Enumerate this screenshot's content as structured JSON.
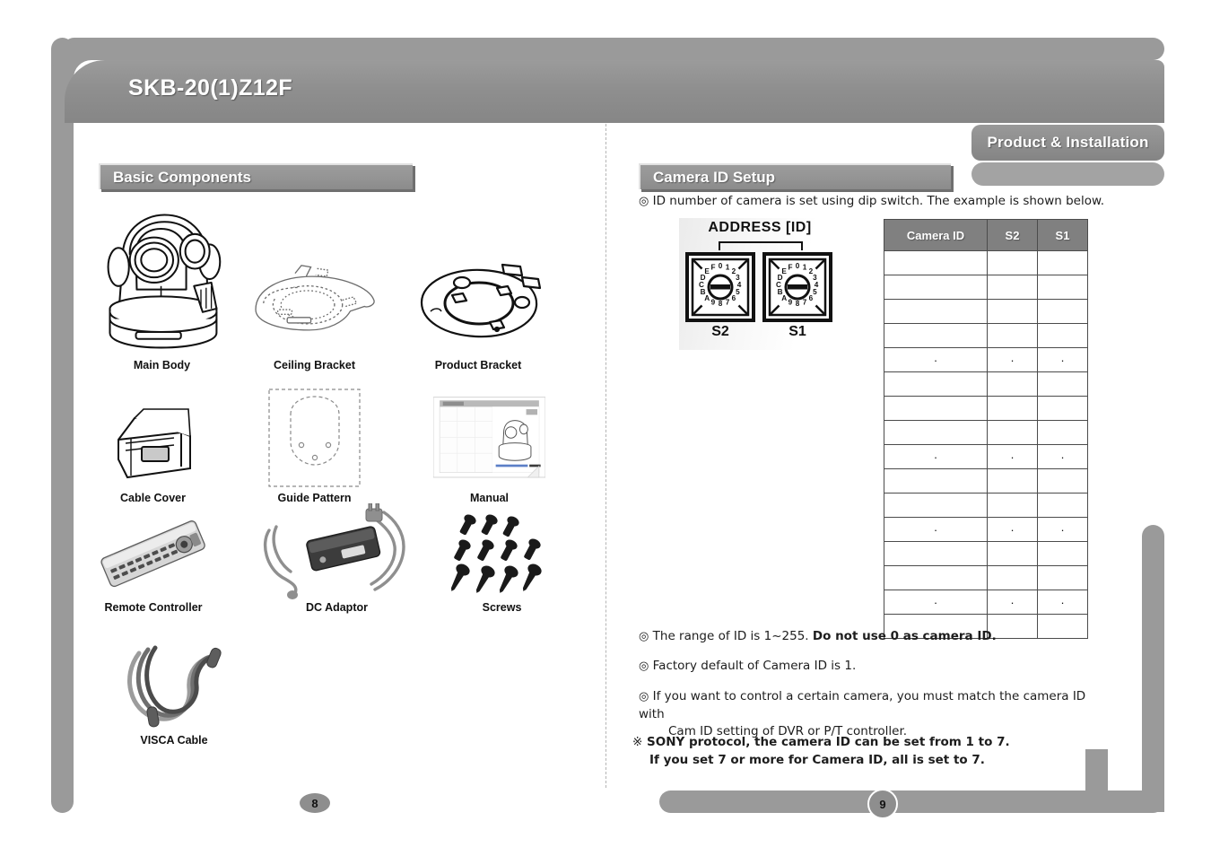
{
  "document": {
    "title": "SKB-20(1)Z12F",
    "tab_label": "Product & Installation"
  },
  "left_page": {
    "section_title": "Basic Components",
    "page_number": "8",
    "components": [
      {
        "id": "main-body",
        "label": "Main Body",
        "icon": "ptz-camera-lineart"
      },
      {
        "id": "ceiling-bracket",
        "label": "Ceiling Bracket",
        "icon": "ceiling-bracket-lineart"
      },
      {
        "id": "product-bracket",
        "label": "Product Bracket",
        "icon": "product-bracket-lineart"
      },
      {
        "id": "cable-cover",
        "label": "Cable Cover",
        "icon": "cable-cover-lineart"
      },
      {
        "id": "guide-pattern",
        "label": "Guide Pattern",
        "icon": "guide-pattern-sheet"
      },
      {
        "id": "manual",
        "label": "Manual",
        "icon": "manual-screenshot"
      },
      {
        "id": "remote-controller",
        "label": "Remote Controller",
        "icon": "remote-controller-photo"
      },
      {
        "id": "dc-adaptor",
        "label": "DC Adaptor",
        "icon": "dc-adaptor-photo"
      },
      {
        "id": "screws",
        "label": "Screws",
        "icon": "screws-photo"
      },
      {
        "id": "visca-cable",
        "label": "VISCA Cable",
        "icon": "visca-cable-photo"
      }
    ]
  },
  "right_page": {
    "section_title": "Camera ID Setup",
    "page_number": "9",
    "intro_note": "ID number of camera is set using dip switch. The example is shown below.",
    "address_figure": {
      "title": "ADDRESS [ID]",
      "switch_left_label": "S2",
      "switch_right_label": "S1",
      "dial_digits": [
        "0",
        "1",
        "2",
        "3",
        "4",
        "5",
        "6",
        "7",
        "8",
        "9",
        "A",
        "B",
        "C",
        "D",
        "E",
        "F"
      ]
    },
    "table": {
      "headers": [
        "Camera ID",
        "S2",
        "S1"
      ],
      "rows": [
        [
          "",
          "",
          ""
        ],
        [
          "",
          "",
          ""
        ],
        [
          "",
          "",
          ""
        ],
        [
          "",
          "",
          ""
        ],
        [
          "·",
          "·",
          "·"
        ],
        [
          "",
          "",
          ""
        ],
        [
          "",
          "",
          ""
        ],
        [
          "",
          "",
          ""
        ],
        [
          "·",
          "·",
          "·"
        ],
        [
          "",
          "",
          ""
        ],
        [
          "",
          "",
          ""
        ],
        [
          "·",
          "·",
          "·"
        ],
        [
          "",
          "",
          ""
        ],
        [
          "",
          "",
          ""
        ],
        [
          "·",
          "·",
          "·"
        ],
        [
          "",
          "",
          ""
        ]
      ]
    },
    "notes": [
      {
        "marker": "◎",
        "text_plain": "The range of ID is 1~255. ",
        "text_bold": "Do not use 0 as camera ID."
      },
      {
        "marker": "◎",
        "text_plain": "Factory default of Camera ID is 1.",
        "text_bold": ""
      },
      {
        "marker": "◎",
        "text_plain": "If you want to control a certain camera, you must match the camera ID with",
        "text_bold": ""
      }
    ],
    "note3_line2": "Cam ID setting of DVR or P/T controller.",
    "warning": {
      "marker": "※",
      "line1": "SONY protocol, the camera ID can be set from 1 to 7.",
      "line2": "If you set 7 or more for Camera ID, all is set to 7."
    }
  },
  "colors": {
    "frame_gray": "#9a9a9a",
    "bar_gray": "#949494",
    "table_header": "#808080",
    "text_dark": "#1d1d1d"
  }
}
